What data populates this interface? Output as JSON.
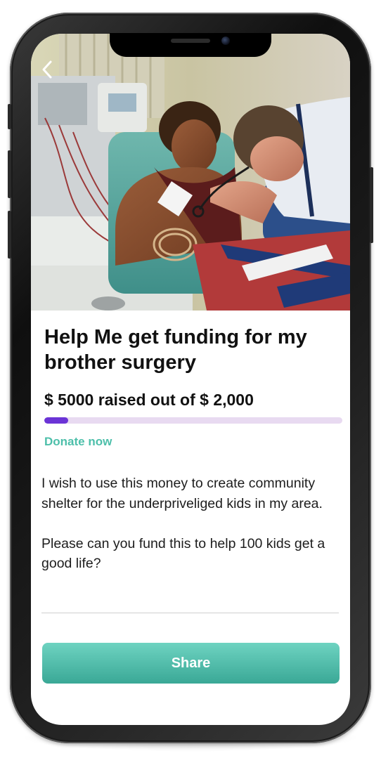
{
  "hero": {
    "back_icon": "chevron-left-icon",
    "image_subject": "photo"
  },
  "campaign": {
    "title": "Help Me get funding for my brother surgery",
    "raised_text": "$ 5000 raised out of $ 2,000",
    "progress_fraction": 0.08,
    "donate_label": "Donate now",
    "description": "I wish to use this money to create community shelter for the underpriveliged kids in my area.\n\nPlease can you fund this to help 100 kids get a good life?"
  },
  "actions": {
    "share_label": "Share"
  },
  "colors": {
    "accent": "#4dbfaa",
    "progress_fill": "#6b34d6",
    "progress_track": "#e8daf1"
  }
}
